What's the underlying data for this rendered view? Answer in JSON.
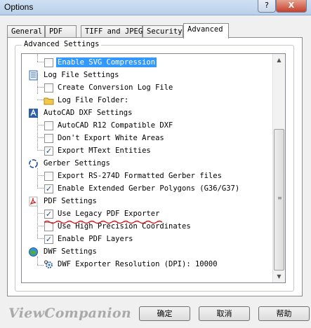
{
  "window": {
    "title": "Options",
    "help_glyph": "?",
    "close_glyph": "X"
  },
  "tabs": [
    {
      "label": "General"
    },
    {
      "label": "PDF"
    },
    {
      "label": "TIFF and JPEG"
    },
    {
      "label": "Security"
    },
    {
      "label": "Advanced"
    }
  ],
  "active_tab": "Advanced",
  "group": {
    "title": "Advanced Settings"
  },
  "tree": {
    "enable_svg_compression": {
      "label": "Enable SVG Compression",
      "checked": false,
      "selected": true
    },
    "log_file_settings": {
      "label": "Log File Settings"
    },
    "create_conversion_log_file": {
      "label": "Create Conversion Log File",
      "checked": false
    },
    "log_file_folder": {
      "label": "Log File Folder:"
    },
    "autocad_dxf_settings": {
      "label": "AutoCAD DXF Settings"
    },
    "autocad_r12": {
      "label": "AutoCAD R12 Compatible DXF",
      "checked": false
    },
    "dont_export_white_areas": {
      "label": "Don't Export White Areas",
      "checked": false
    },
    "export_mtext_entities": {
      "label": "Export MText Entities",
      "checked": true
    },
    "gerber_settings": {
      "label": "Gerber Settings"
    },
    "export_rs274d": {
      "label": "Export RS-274D Formatted Gerber files",
      "checked": false
    },
    "enable_extended_gerber": {
      "label": "Enable Extended Gerber Polygons (G36/G37)",
      "checked": true
    },
    "pdf_settings": {
      "label": "PDF Settings"
    },
    "use_legacy_pdf_exporter": {
      "label": "Use Legacy PDF Exporter",
      "checked": true
    },
    "use_high_precision": {
      "label": "Use High Precision Coordinates",
      "checked": false
    },
    "enable_pdf_layers": {
      "label": "Enable PDF Layers",
      "checked": true
    },
    "dwf_settings": {
      "label": "DWF Settings"
    },
    "dwf_resolution": {
      "label": "DWF Exporter Resolution (DPI): 10000"
    }
  },
  "check_glyph": "✓",
  "footer": {
    "brand": "ViewCompanion",
    "ok_label": "确定",
    "cancel_label": "取消",
    "help_label": "帮助"
  },
  "colors": {
    "selection": "#3399ff",
    "annotation": "#e01010",
    "brand": "#a9a9a9"
  },
  "icons": {
    "log_file_settings": "log-file-icon",
    "log_file_folder": "folder-icon",
    "autocad_dxf_settings": "autocad-icon",
    "gerber_settings": "gerber-icon",
    "pdf_settings": "pdf-icon",
    "dwf_settings": "dwf-globe-icon",
    "dwf_resolution": "gear-icon"
  }
}
